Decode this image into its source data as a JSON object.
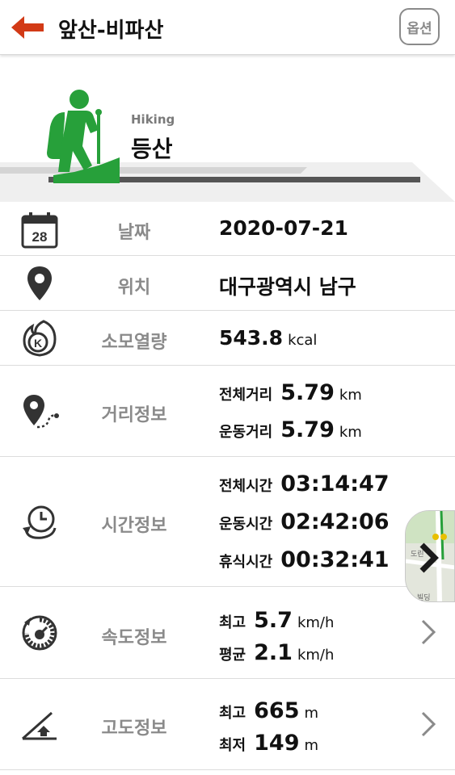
{
  "header": {
    "title": "앞산-비파산",
    "option_label": "옵션",
    "back_icon": "arrow-left-icon",
    "accent_color": "#d23a16"
  },
  "activity": {
    "name_en": "Hiking",
    "name_ko": "등산",
    "icon": "hiker-icon",
    "icon_color": "#27a03a"
  },
  "rows": {
    "date": {
      "label": "날짜",
      "value": "2020-07-21",
      "icon": "calendar-icon"
    },
    "location": {
      "label": "위치",
      "value": "대구광역시 남구",
      "icon": "location-pin-icon"
    },
    "calories": {
      "label": "소모열량",
      "value": "543.8",
      "unit": "kcal",
      "icon": "calorie-fire-icon"
    },
    "distance": {
      "label": "거리정보",
      "icon": "route-pin-icon",
      "total_key": "전체거리",
      "total_value": "5.79",
      "total_unit": "km",
      "moving_key": "운동거리",
      "moving_value": "5.79",
      "moving_unit": "km"
    },
    "time": {
      "label": "시간정보",
      "icon": "clock-icon",
      "total_key": "전체시간",
      "total_value": "03:14:47",
      "moving_key": "운동시간",
      "moving_value": "02:42:06",
      "rest_key": "휴식시간",
      "rest_value": "00:32:41"
    },
    "speed": {
      "label": "속도정보",
      "icon": "speedometer-icon",
      "max_key": "최고",
      "max_value": "5.7",
      "max_unit": "km/h",
      "avg_key": "평균",
      "avg_value": "2.1",
      "avg_unit": "km/h"
    },
    "altitude": {
      "label": "고도정보",
      "icon": "altitude-icon",
      "max_key": "최고",
      "max_value": "665",
      "max_unit": "m",
      "min_key": "최저",
      "min_value": "149",
      "min_unit": "m"
    }
  },
  "map_thumb": {
    "label_1": "도린",
    "label_2": "빌딩",
    "arrow_icon": "chevron-right-icon"
  }
}
